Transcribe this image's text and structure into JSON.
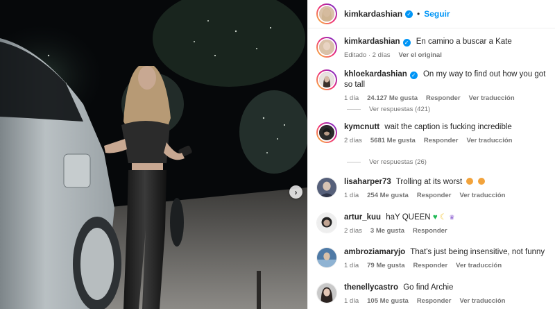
{
  "post": {
    "author": "kimkardashian",
    "follow_label": "Seguir",
    "separator": "•"
  },
  "caption": {
    "username": "kimkardashian",
    "text": "En camino a buscar a Kate",
    "time": "Editado · 2 días",
    "see_original": "Ver el original"
  },
  "comments": [
    {
      "username": "khloekardashian",
      "text": "On my way to find out how you got so tall",
      "time": "1 día",
      "likes": "24.127 Me gusta",
      "reply": "Responder",
      "translate": "Ver traducción",
      "replies": "Ver respuestas (421)"
    },
    {
      "username": "kymcnutt",
      "text": "wait the caption is fucking incredible",
      "time": "2 días",
      "likes": "5681 Me gusta",
      "reply": "Responder",
      "translate": "Ver traducción",
      "replies": "Ver respuestas (26)"
    },
    {
      "username": "lisaharper73",
      "text": "Trolling at its worst",
      "time": "1 día",
      "likes": "254 Me gusta",
      "reply": "Responder",
      "translate": "Ver traducción"
    },
    {
      "username": "artur_kuu",
      "text": "haY QUEEN",
      "time": "2 días",
      "likes": "3 Me gusta",
      "reply": "Responder"
    },
    {
      "username": "ambroziamaryjo",
      "text": "That's just being insensitive, not funny",
      "time": "1 día",
      "likes": "79 Me gusta",
      "reply": "Responder",
      "translate": "Ver traducción"
    },
    {
      "username": "thenellycastro",
      "text": "Go find Archie",
      "time": "1 día",
      "likes": "105 Me gusta",
      "reply": "Responder",
      "translate": "Ver traducción"
    }
  ],
  "icons": {
    "verified": "verified-check-icon",
    "next": "chevron-right-icon",
    "heart_emoji": "green-heart-icon",
    "moon_emoji": "moon-icon",
    "scream_emoji": "screaming-face-icon"
  },
  "colors": {
    "accent": "#0095f6",
    "muted": "#737373",
    "text": "#262626"
  }
}
